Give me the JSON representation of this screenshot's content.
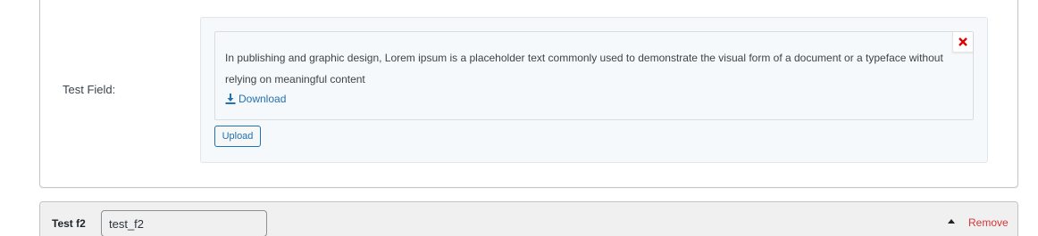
{
  "field": {
    "label": "Test Field:"
  },
  "file": {
    "description": "In publishing and graphic design, Lorem ipsum is a placeholder text commonly used to demonstrate the visual form of a document or a typeface without relying on meaningful content",
    "download_label": "Download",
    "remove_icon": "close-icon"
  },
  "upload": {
    "label": "Upload"
  },
  "row": {
    "title": "Test f2",
    "input_value": "test_f2",
    "toggle_icon": "caret-up-icon",
    "remove_label": "Remove"
  },
  "colors": {
    "link": "#2271b1",
    "remove": "#d63638",
    "close_x": "#e00000"
  }
}
